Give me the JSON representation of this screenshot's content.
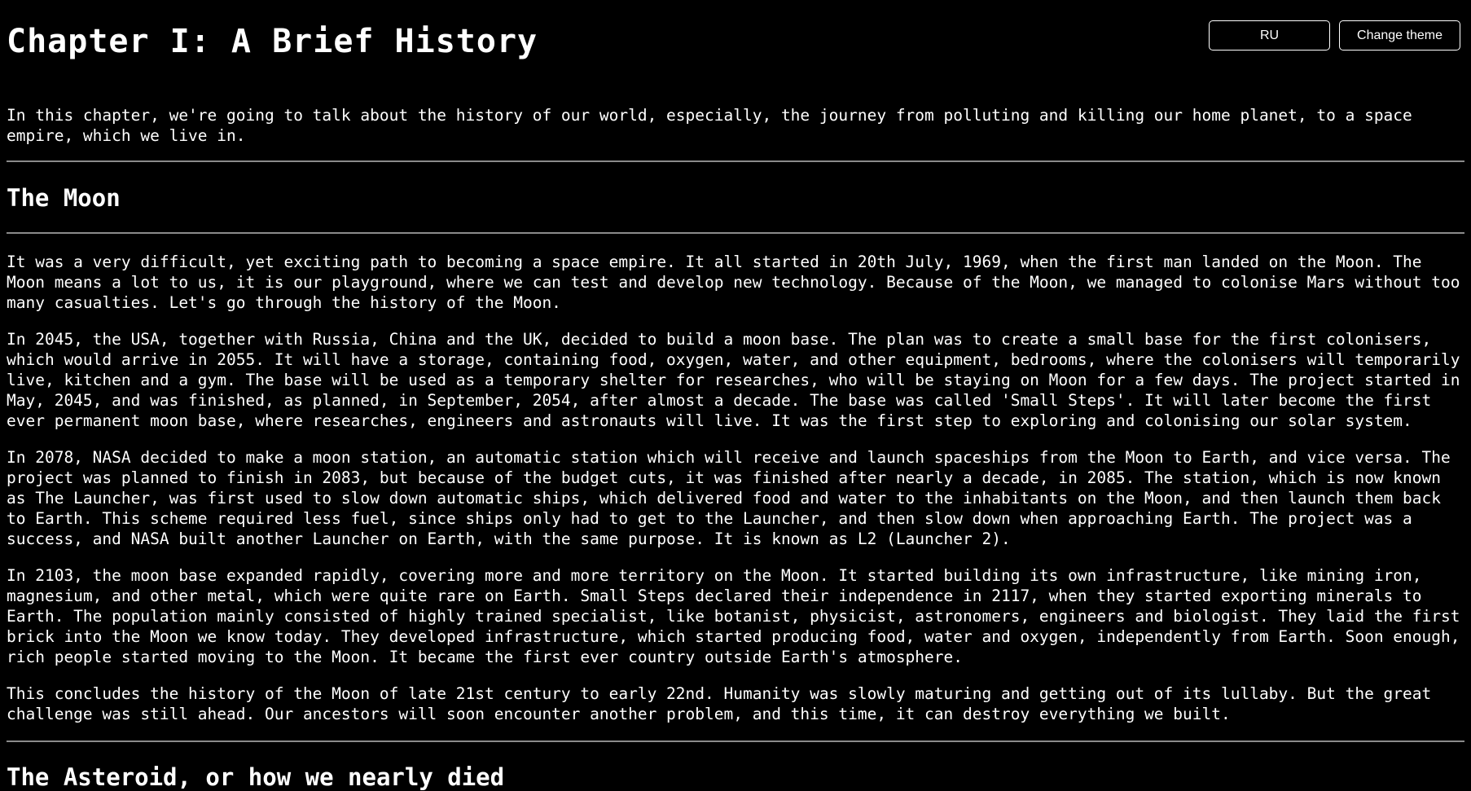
{
  "header": {
    "title": "Chapter I: A Brief History",
    "lang_button": "RU",
    "theme_button": "Change theme"
  },
  "intro": "In this chapter, we're going to talk about the history of our world, especially, the journey from polluting and killing our home planet, to a space empire, which we live in.",
  "sections": {
    "moon": {
      "title": "The Moon",
      "paragraphs": [
        "It was a very difficult, yet exciting path to becoming a space empire. It all started in 20th July, 1969, when the first man landed on the Moon. The Moon means a lot to us, it is our playground, where we can test and develop new technology. Because of the Moon, we managed to colonise Mars without too many casualties. Let's go through the history of the Moon.",
        "In 2045, the USA, together with Russia, China and the UK, decided to build a moon base. The plan was to create a small base for the first colonisers, which would arrive in 2055. It will have a storage, containing food, oxygen, water, and other equipment, bedrooms, where the colonisers will temporarily live, kitchen and a gym. The base will be used as a temporary shelter for researches, who will be staying on Moon for a few days. The project started in May, 2045, and was finished, as planned, in September, 2054, after almost a decade. The base was called 'Small Steps'. It will later become the first ever permanent moon base, where researches, engineers and astronauts will live. It was the first step to exploring and colonising our solar system.",
        "In 2078, NASA decided to make a moon station, an automatic station which will receive and launch spaceships from the Moon to Earth, and vice versa. The project was planned to finish in 2083, but because of the budget cuts, it was finished after nearly a decade, in 2085. The station, which is now known as The Launcher, was first used to slow down automatic ships, which delivered food and water to the inhabitants on the Moon, and then launch them back to Earth. This scheme required less fuel, since ships only had to get to the Launcher, and then slow down when approaching Earth. The project was a success, and NASA built another Launcher on Earth, with the same purpose. It is known as L2 (Launcher 2).",
        "In 2103, the moon base expanded rapidly, covering more and more territory on the Moon. It started building its own infrastructure, like mining iron, magnesium, and other metal, which were quite rare on Earth. Small Steps declared their independence in 2117, when they started exporting minerals to Earth. The population mainly consisted of highly trained specialist, like botanist, physicist, astronomers, engineers and biologist. They laid the first brick into the Moon we know today. They developed infrastructure, which started producing food, water and oxygen, independently from Earth. Soon enough, rich people started moving to the Moon. It became the first ever country outside Earth's atmosphere.",
        "This concludes the history of the Moon of late 21st century to early 22nd. Humanity was slowly maturing and getting out of its lullaby. But the great challenge was still ahead. Our ancestors will soon encounter another problem, and this time, it can destroy everything we built."
      ]
    },
    "asteroid": {
      "title": "The Asteroid, or how we nearly died"
    }
  }
}
